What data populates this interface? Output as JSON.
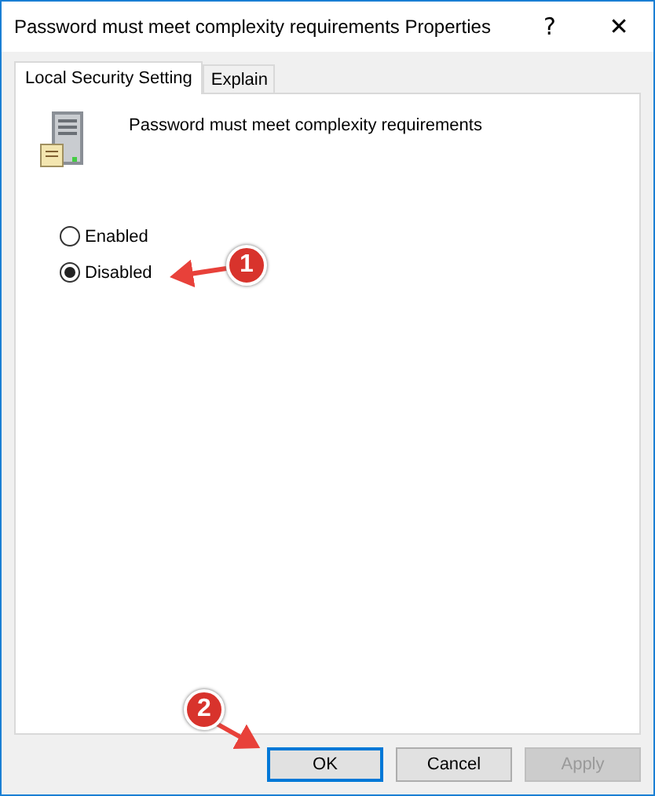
{
  "window": {
    "title": "Password must meet complexity requirements Properties",
    "help": "?",
    "close": "✕"
  },
  "tabs": [
    {
      "label": "Local Security Setting",
      "selected": true
    },
    {
      "label": "Explain",
      "selected": false
    }
  ],
  "policy": {
    "name": "Password must meet complexity requirements"
  },
  "options": [
    {
      "label": "Enabled",
      "selected": false
    },
    {
      "label": "Disabled",
      "selected": true
    }
  ],
  "buttons": [
    {
      "label": "OK",
      "default": true,
      "disabled": false
    },
    {
      "label": "Cancel",
      "default": false,
      "disabled": false
    },
    {
      "label": "Apply",
      "default": false,
      "disabled": true
    }
  ],
  "callouts": [
    {
      "number": "1"
    },
    {
      "number": "2"
    }
  ]
}
